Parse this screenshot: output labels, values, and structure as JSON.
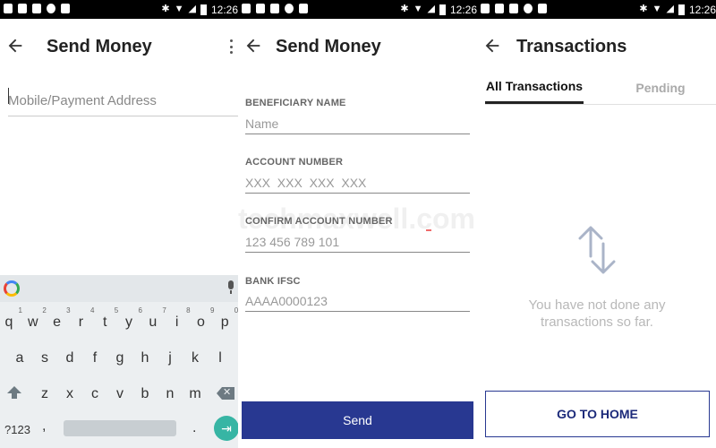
{
  "status_bar": {
    "time": "12:26"
  },
  "screen1": {
    "title": "Send Money",
    "mobile_placeholder": "Mobile/Payment Address",
    "keyboard": {
      "row1": [
        "q",
        "w",
        "e",
        "r",
        "t",
        "y",
        "u",
        "i",
        "o",
        "p"
      ],
      "row1_hints": [
        "1",
        "2",
        "3",
        "4",
        "5",
        "6",
        "7",
        "8",
        "9",
        "0"
      ],
      "row2": [
        "a",
        "s",
        "d",
        "f",
        "g",
        "h",
        "j",
        "k",
        "l"
      ],
      "row3": [
        "z",
        "x",
        "c",
        "v",
        "b",
        "n",
        "m"
      ],
      "symbols_key": "?123",
      "comma_key": ",",
      "period_key": "."
    }
  },
  "screen2": {
    "title": "Send Money",
    "fields": [
      {
        "label": "BENEFICIARY NAME",
        "placeholder": "Name"
      },
      {
        "label": "ACCOUNT NUMBER",
        "placeholder": "XXX  XXX  XXX  XXX"
      },
      {
        "label": "CONFIRM ACCOUNT NUMBER",
        "placeholder": "123 456 789 101"
      },
      {
        "label": "BANK IFSC",
        "placeholder": "AAAA0000123"
      }
    ],
    "send_label": "Send",
    "watermark": "techmaxwell.com"
  },
  "screen3": {
    "title": "Transactions",
    "tabs": [
      "All Transactions",
      "Pending"
    ],
    "empty_message": "You have not done any transactions so far.",
    "home_label": "GO TO HOME"
  },
  "colors": {
    "primary": "#283891",
    "enter_key": "#37b5a4",
    "icon_muted": "#aab4c8"
  }
}
